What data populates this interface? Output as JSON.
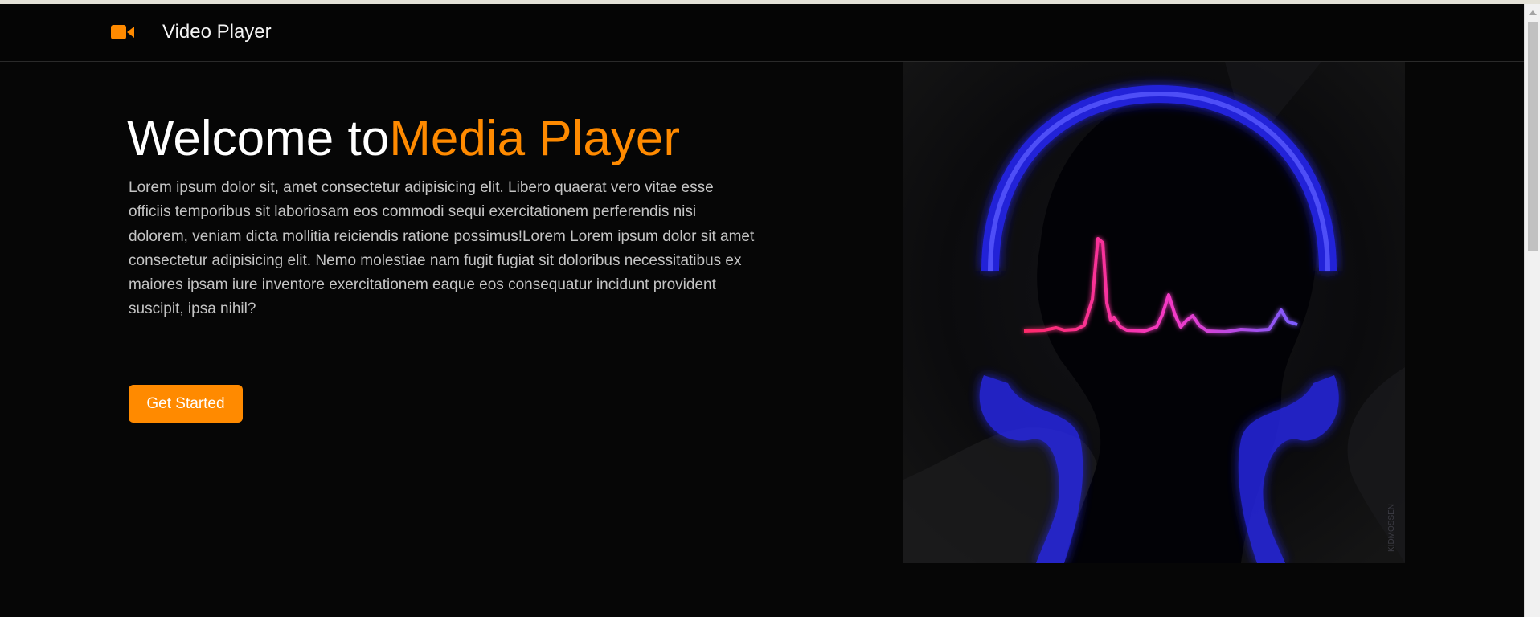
{
  "navbar": {
    "logo_icon": "video-camera-icon",
    "brand": "Video Player",
    "accent_color": "#ff8a00"
  },
  "hero": {
    "title_prefix": "Welcome to",
    "title_accent": "Media Player",
    "paragraph": "Lorem ipsum dolor sit, amet consectetur adipisicing elit. Libero quaerat vero vitae esse officiis temporibus sit laboriosam eos commodi sequi exercitationem perferendis nisi dolorem, veniam dicta mollitia reiciendis ratione possimus!Lorem Lorem ipsum dolor sit amet consectetur adipisicing elit. Nemo molestiae nam fugit fugiat sit doloribus necessitatibus ex maiores ipsam iure inventore exercitationem eaque eos consequatur incidunt provident suscipit, ipsa nihil?",
    "cta_label": "Get Started",
    "image_icon": "headphones-heartbeat-illustration",
    "image_signature": "KIDMOSSEN"
  },
  "colors": {
    "background": "#060606",
    "text": "#ffffff",
    "muted_text": "#c4c4c4",
    "accent": "#ff8a00",
    "headphone_glow": "#2b2bff",
    "wave_pink": "#ff2a8a",
    "wave_violet": "#8a5cff"
  }
}
